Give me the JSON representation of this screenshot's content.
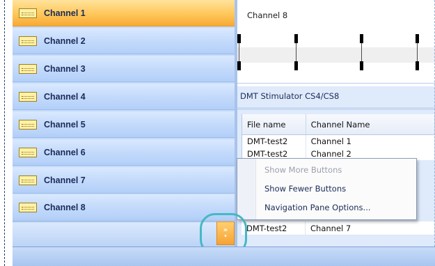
{
  "nav": {
    "items": [
      {
        "label": "Channel 1",
        "active": true
      },
      {
        "label": "Channel 2",
        "active": false
      },
      {
        "label": "Channel 3",
        "active": false
      },
      {
        "label": "Channel 4",
        "active": false
      },
      {
        "label": "Channel 5",
        "active": false
      },
      {
        "label": "Channel 6",
        "active": false
      },
      {
        "label": "Channel 7",
        "active": false
      },
      {
        "label": "Channel 8",
        "active": false
      }
    ],
    "overflow_button": {
      "chevron": "»",
      "arrow": "▾"
    }
  },
  "viewer": {
    "title": "Channel 8"
  },
  "grid": {
    "title": "DMT Stimulator CS4/CS8",
    "columns": [
      "File name",
      "Channel Name"
    ],
    "rows": [
      [
        "DMT-test2",
        "Channel 1"
      ],
      [
        "DMT-test2",
        "Channel 2"
      ]
    ],
    "last_row": [
      "DMT-test2",
      "Channel 7"
    ]
  },
  "context_menu": {
    "items": [
      {
        "label": "Show More Buttons",
        "enabled": false
      },
      {
        "label": "Show Fewer Buttons",
        "enabled": true
      },
      {
        "label": "Navigation Pane Options...",
        "enabled": true
      }
    ]
  },
  "colors": {
    "active_item": "#ffc75a",
    "nav_item": "#c2d9fb",
    "highlight_ring": "#45b8c4",
    "overflow_button": "#f7a233"
  }
}
